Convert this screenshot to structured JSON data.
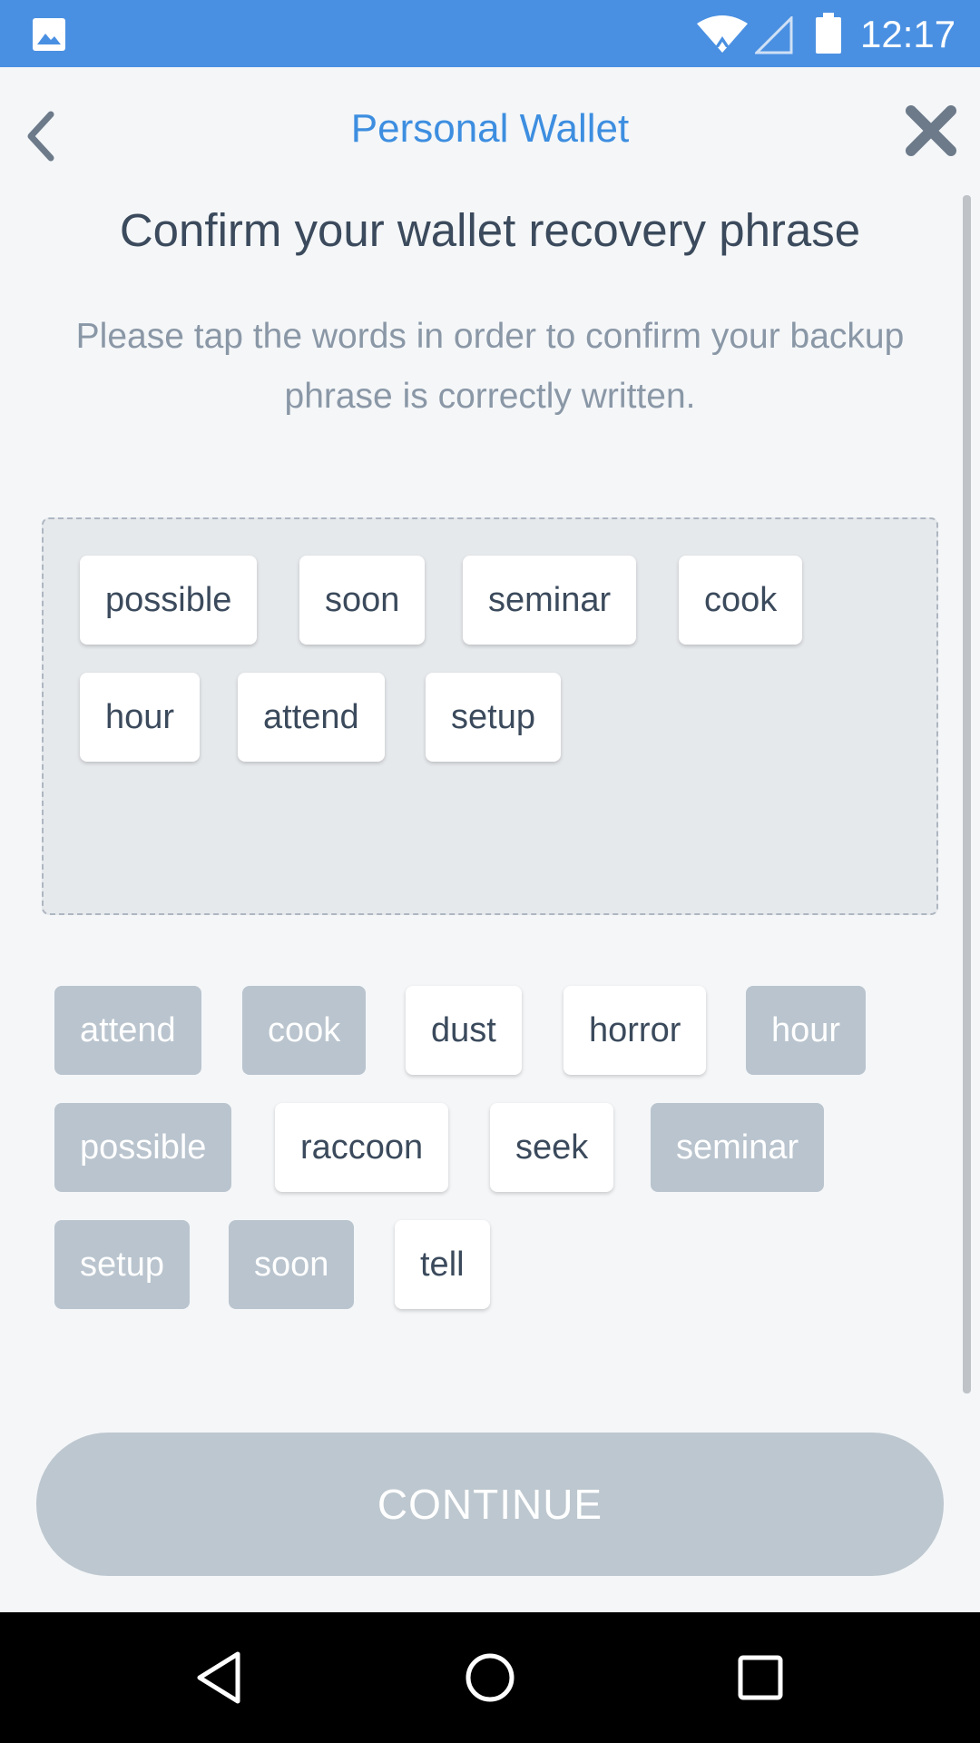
{
  "status_bar": {
    "time": "12:17",
    "icons": [
      "image-icon",
      "wifi-icon",
      "signal-icon",
      "battery-icon"
    ]
  },
  "header": {
    "title": "Personal Wallet",
    "back_icon": "chevron-left-icon",
    "close_icon": "close-icon"
  },
  "content": {
    "title": "Confirm your wallet recovery phrase",
    "instructions": "Please tap the words in order to confirm your backup phrase is correctly written."
  },
  "selected_words": [
    "possible",
    "soon",
    "seminar",
    "cook",
    "hour",
    "attend",
    "setup"
  ],
  "word_options": [
    {
      "label": "attend",
      "used": true
    },
    {
      "label": "cook",
      "used": true
    },
    {
      "label": "dust",
      "used": false
    },
    {
      "label": "horror",
      "used": false
    },
    {
      "label": "hour",
      "used": true
    },
    {
      "label": "possible",
      "used": true
    },
    {
      "label": "raccoon",
      "used": false
    },
    {
      "label": "seek",
      "used": false
    },
    {
      "label": "seminar",
      "used": true
    },
    {
      "label": "setup",
      "used": true
    },
    {
      "label": "soon",
      "used": true
    },
    {
      "label": "tell",
      "used": false
    }
  ],
  "continue_button": {
    "label": "CONTINUE",
    "enabled": false
  },
  "nav_bar": {
    "icons": [
      "nav-back-icon",
      "nav-home-icon",
      "nav-recents-icon"
    ]
  },
  "colors": {
    "status_bar": "#4a90e2",
    "accent": "#3d8ee0",
    "chip_used": "#b9c4ce",
    "button_disabled": "#bdc7cf",
    "background": "#f4f6f8"
  }
}
